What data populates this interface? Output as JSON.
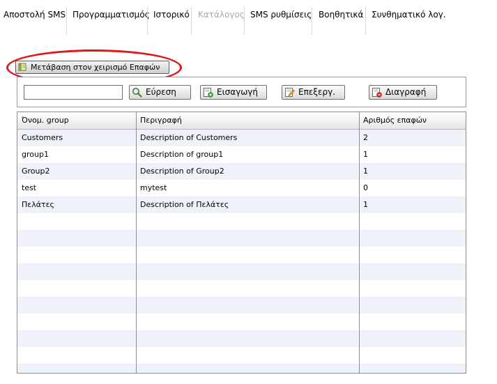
{
  "nav": {
    "items": [
      {
        "label": "Αποστολή SMS",
        "enabled": true
      },
      {
        "label": "Προγραμματισμός",
        "enabled": true
      },
      {
        "label": "Ιστορικό",
        "enabled": true
      },
      {
        "label": "Κατάλογος",
        "enabled": false
      },
      {
        "label": "SMS ρυθμίσεις",
        "enabled": true
      },
      {
        "label": "Βοηθητικά",
        "enabled": true
      },
      {
        "label": "Συνθηματικό λογ.",
        "enabled": true
      }
    ]
  },
  "contacts_button": {
    "label": "Μετάβαση στον χειρισμό Επαφών",
    "icon": "book-icon"
  },
  "toolbar": {
    "search_value": "",
    "search_label": "Εύρεση",
    "insert_label": "Εισαγωγή",
    "edit_label": "Επεξεργ.",
    "delete_label": "Διαγραφή"
  },
  "grid": {
    "columns": [
      "Όνομ. group",
      "Περιγραφή",
      "Αριθμός επαφών"
    ],
    "rows": [
      {
        "name": "Customers",
        "description": "Description of Customers",
        "count": "2"
      },
      {
        "name": "group1",
        "description": "Description of group1",
        "count": "1"
      },
      {
        "name": "Group2",
        "description": "Description of Group2",
        "count": "1"
      },
      {
        "name": "test",
        "description": "mytest",
        "count": "0"
      },
      {
        "name": "Πελάτες",
        "description": "Description of Πελάτες",
        "count": "1"
      }
    ],
    "empty_rows": 10
  },
  "colors": {
    "highlight_ellipse": "#e01818",
    "row_alt": "#eef3fa",
    "disabled_text": "#a9a9a9"
  }
}
